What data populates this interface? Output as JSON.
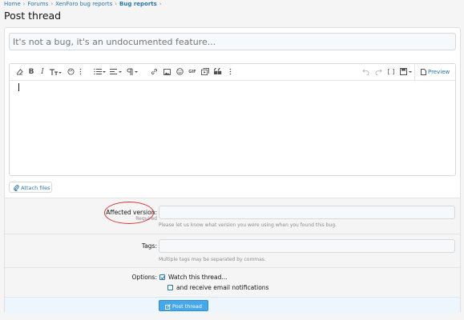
{
  "breadcrumb": {
    "items": [
      "Home",
      "Forums",
      "XenForo bug reports",
      "Bug reports"
    ],
    "separator": "›"
  },
  "page": {
    "title": "Post thread"
  },
  "thread_title": {
    "placeholder": "It's not a bug, it's an undocumented feature..."
  },
  "editor": {
    "preview_label": "Preview",
    "toolbar_icons": [
      "eraser-icon",
      "bold-icon",
      "italic-icon",
      "text-size-icon",
      "palette-icon",
      "more-icon",
      "list-icon",
      "align-icon",
      "paragraph-icon",
      "link-icon",
      "image-icon",
      "smiley-icon",
      "gif-icon",
      "media-icon",
      "quote-icon",
      "more-icon"
    ],
    "gif_label": "GIF"
  },
  "attach": {
    "label": "Attach files"
  },
  "form": {
    "affected_version": {
      "label": "Affected version:",
      "required": "Required",
      "hint": "Please let us know what version you were using when you found this bug."
    },
    "tags": {
      "label": "Tags:",
      "hint": "Multiple tags may be separated by commas."
    },
    "options": {
      "label": "Options:",
      "watch_label": "Watch this thread...",
      "watch_checked": true,
      "email_label": "and receive email notifications",
      "email_checked": false
    }
  },
  "submit": {
    "label": "Post thread"
  },
  "colors": {
    "accent": "#2577b1",
    "button": "#47a7eb",
    "annotation": "#dd3333"
  }
}
